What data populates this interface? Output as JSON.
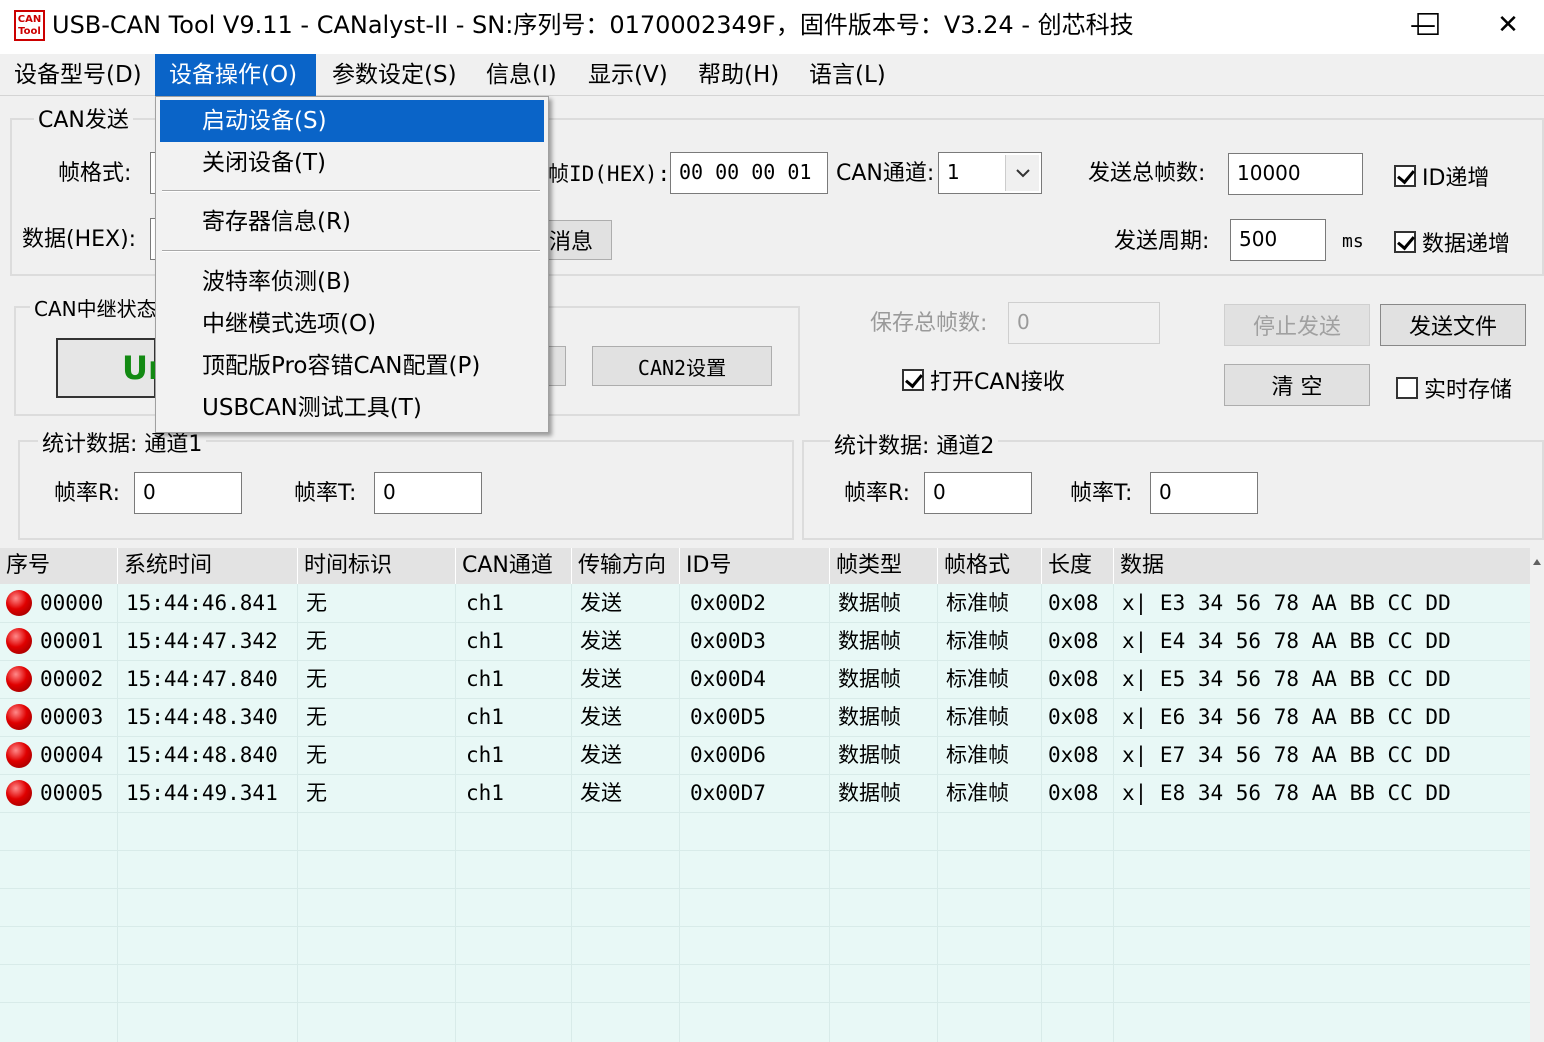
{
  "window": {
    "title": "USB-CAN Tool V9.11 - CANalyst-II - SN:序列号：0170002349F，固件版本号：V3.24 - 创芯科技",
    "icon_text_top": "CAN",
    "icon_text_bottom": "Tool",
    "minimize_glyph": "—",
    "maximize_glyph": "☐",
    "close_glyph": "✕"
  },
  "menubar": {
    "items": [
      "设备型号(D)",
      "设备操作(O)",
      "参数设定(S)",
      "信息(I)",
      "显示(V)",
      "帮助(H)",
      "语言(L)"
    ]
  },
  "dropdown": {
    "items": [
      "启动设备(S)",
      "关闭设备(T)",
      "寄存器信息(R)",
      "波特率侦测(B)",
      "中继模式选项(O)",
      "顶配版Pro容错CAN配置(P)",
      "USBCAN测试工具(T)"
    ]
  },
  "can_send": {
    "group_title": "CAN发送",
    "frame_format_label": "帧格式:",
    "frame_id_label": "帧ID(HEX):",
    "frame_id_value": "00 00 00 01",
    "channel_label": "CAN通道:",
    "channel_value": "1",
    "total_frames_label": "发送总帧数:",
    "total_frames_value": "10000",
    "id_increment_label": "ID递增",
    "data_label": "数据(HEX):",
    "send_msg_partial": "消息",
    "period_label": "发送周期:",
    "period_value": "500",
    "period_unit": "ms",
    "data_increment_label": "数据递增"
  },
  "relay": {
    "group_title": "CAN中继状态",
    "status_partial": "Ur",
    "can2_button": "CAN2设置"
  },
  "right_controls": {
    "saved_frames_label": "保存总帧数:",
    "saved_frames_value": "0",
    "stop_send": "停止发送",
    "send_file": "发送文件",
    "open_can_receive": "打开CAN接收",
    "clear": "清  空",
    "realtime_save": "实时存储"
  },
  "stats1": {
    "group_title": "统计数据: 通道1",
    "rate_r_label": "帧率R:",
    "rate_r_value": "0",
    "rate_t_label": "帧率T:",
    "rate_t_value": "0"
  },
  "stats2": {
    "group_title": "统计数据: 通道2",
    "rate_r_label": "帧率R:",
    "rate_r_value": "0",
    "rate_t_label": "帧率T:",
    "rate_t_value": "0"
  },
  "table": {
    "headers": [
      "序号",
      "系统时间",
      "时间标识",
      "CAN通道",
      "传输方向",
      "ID号",
      "帧类型",
      "帧格式",
      "长度",
      "数据"
    ],
    "rows": [
      [
        "00000",
        "15:44:46.841",
        "无",
        "ch1",
        "发送",
        "0x00D2",
        "数据帧",
        "标准帧",
        "0x08",
        "x| E3 34 56 78 AA BB CC DD"
      ],
      [
        "00001",
        "15:44:47.342",
        "无",
        "ch1",
        "发送",
        "0x00D3",
        "数据帧",
        "标准帧",
        "0x08",
        "x| E4 34 56 78 AA BB CC DD"
      ],
      [
        "00002",
        "15:44:47.840",
        "无",
        "ch1",
        "发送",
        "0x00D4",
        "数据帧",
        "标准帧",
        "0x08",
        "x| E5 34 56 78 AA BB CC DD"
      ],
      [
        "00003",
        "15:44:48.340",
        "无",
        "ch1",
        "发送",
        "0x00D5",
        "数据帧",
        "标准帧",
        "0x08",
        "x| E6 34 56 78 AA BB CC DD"
      ],
      [
        "00004",
        "15:44:48.840",
        "无",
        "ch1",
        "发送",
        "0x00D6",
        "数据帧",
        "标准帧",
        "0x08",
        "x| E7 34 56 78 AA BB CC DD"
      ],
      [
        "00005",
        "15:44:49.341",
        "无",
        "ch1",
        "发送",
        "0x00D7",
        "数据帧",
        "标准帧",
        "0x08",
        "x| E8 34 56 78 AA BB CC DD"
      ]
    ]
  },
  "colors": {
    "accent": "#0a64c8",
    "table_bg": "#e8f8f6",
    "status_dot": "#e00000"
  }
}
